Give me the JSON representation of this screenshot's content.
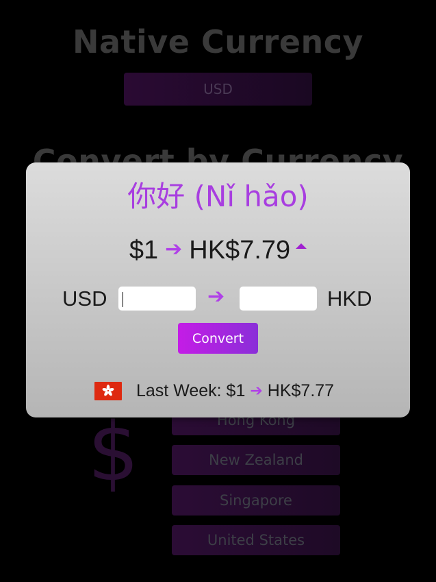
{
  "background": {
    "native_title": "Native Currency",
    "native_value": "USD",
    "convert_title": "Convert by Currency",
    "dollar_glyph": "$",
    "countries": [
      "Hong Kong",
      "New Zealand",
      "Singapore",
      "United States"
    ]
  },
  "modal": {
    "greeting": "你好 (Nǐ hǎo)",
    "rate": {
      "from": "$1",
      "to": "HK$7.79",
      "trend": "up",
      "trend_icon": "caret-up-icon"
    },
    "converter": {
      "from_currency": "USD",
      "to_currency": "HKD",
      "from_value": "",
      "to_value": "",
      "arrow_icon": "arrow-right-icon"
    },
    "convert_label": "Convert",
    "last_week": {
      "label": "Last Week: $1",
      "to": "HK$7.77",
      "flag_icon": "hong-kong-flag-icon"
    }
  },
  "colors": {
    "accent": "#b040e8",
    "button_start": "#c41ce6",
    "button_end": "#8a2fd8",
    "flag_red": "#de2910"
  }
}
